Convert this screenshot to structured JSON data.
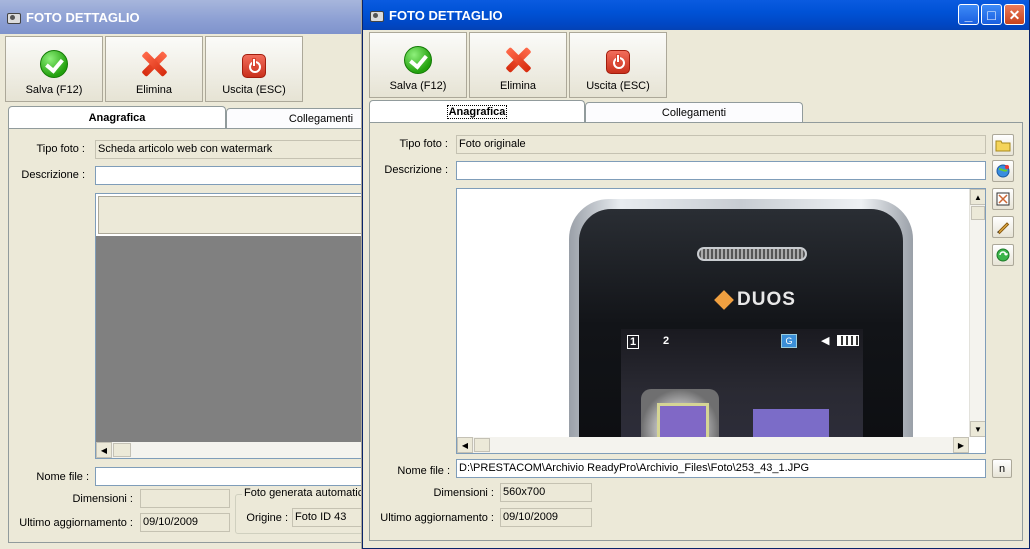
{
  "window_back": {
    "title": "FOTO DETTAGLIO",
    "toolbar": {
      "save": "Salva (F12)",
      "delete": "Elimina",
      "exit": "Uscita (ESC)"
    },
    "tabs": [
      {
        "label": "Anagrafica",
        "active": true
      },
      {
        "label": "Collegamenti",
        "active": false
      }
    ],
    "form": {
      "tipo_foto_label": "Tipo foto :",
      "tipo_foto_value": "Scheda articolo web con watermark",
      "descrizione_label": "Descrizione :",
      "descrizione_value": "",
      "nome_file_label": "Nome file :",
      "nome_file_value": "",
      "dimensioni_label": "Dimensioni :",
      "dimensioni_value": "",
      "ultimo_label": "Ultimo aggiornamento :",
      "ultimo_value": "09/10/2009",
      "group_title": "Foto generata automatic",
      "origine_label": "Origine :",
      "origine_value": "Foto ID 43"
    }
  },
  "window_front": {
    "title": "FOTO DETTAGLIO",
    "window_buttons": {
      "minimize": "_",
      "maximize": "□",
      "close": "✕"
    },
    "toolbar": {
      "save": "Salva (F12)",
      "delete": "Elimina",
      "exit": "Uscita (ESC)"
    },
    "tabs": [
      {
        "label": "Anagrafica",
        "active": true
      },
      {
        "label": "Collegamenti",
        "active": false
      }
    ],
    "form": {
      "tipo_foto_label": "Tipo foto :",
      "tipo_foto_value": "Foto originale",
      "descrizione_label": "Descrizione :",
      "descrizione_value": "",
      "nome_file_label": "Nome file :",
      "nome_file_value": "D:\\PRESTACOM\\Archivio ReadyPro\\Archivio_Files\\Foto\\253_43_1.JPG",
      "nome_file_button": "n",
      "dimensioni_label": "Dimensioni :",
      "dimensioni_value": "560x700",
      "ultimo_label": "Ultimo aggiornamento :",
      "ultimo_value": "09/10/2009"
    },
    "image": {
      "brand": "DUOS",
      "sim1": "1",
      "sim2": "2",
      "status_g": "G"
    },
    "side_icons": [
      "folder-icon",
      "web-globe-icon",
      "resize-icon",
      "edit-brush-icon",
      "recycle-icon"
    ]
  },
  "colors": {
    "titlebar_active": "#0052d6",
    "titlebar_inactive": "#8c9fd3",
    "window_bg": "#ece9d8"
  }
}
